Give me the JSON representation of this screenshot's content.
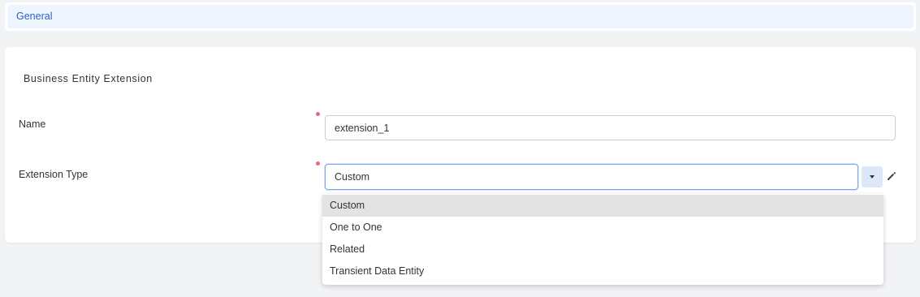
{
  "tabs": {
    "general_label": "General"
  },
  "form": {
    "section_title": "Business Entity Extension",
    "name_label": "Name",
    "name_value": "extension_1",
    "extension_type_label": "Extension Type",
    "extension_type_value": "Custom"
  },
  "dropdown": {
    "options": [
      "Custom",
      "One to One",
      "Related",
      "Transient Data Entity"
    ],
    "selected_index": 0
  },
  "icons": {
    "dropdown": "chevron-down-icon",
    "edit": "pencil-icon"
  },
  "colors": {
    "accent": "#2a63c2",
    "required": "#e8687a",
    "tab_background": "#eef5ff",
    "selected_option": "#e3e3e3"
  }
}
